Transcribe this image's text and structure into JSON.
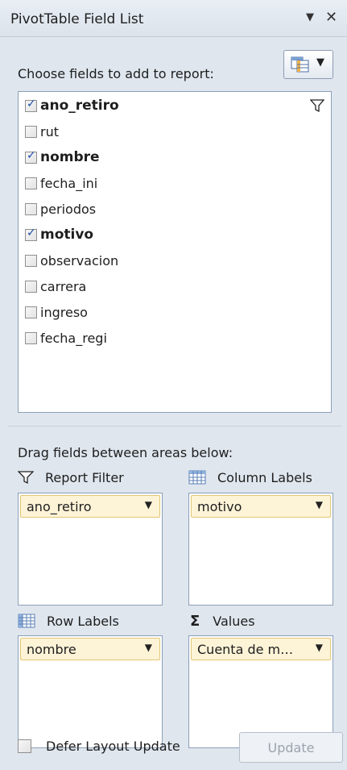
{
  "panel": {
    "title": "PivotTable Field List",
    "dropdown_icon": "triangle-down-icon",
    "close_icon": "close-icon"
  },
  "chooser": {
    "label": "Choose fields to add to report:",
    "layout_button_icon": "field-layout-icon"
  },
  "fields": [
    {
      "name": "ano_retiro",
      "checked": true,
      "filtered": true
    },
    {
      "name": "rut",
      "checked": false
    },
    {
      "name": "nombre",
      "checked": true
    },
    {
      "name": "fecha_ini",
      "checked": false
    },
    {
      "name": "periodos",
      "checked": false
    },
    {
      "name": "motivo",
      "checked": true
    },
    {
      "name": "observacion",
      "checked": false
    },
    {
      "name": "carrera",
      "checked": false
    },
    {
      "name": "ingreso",
      "checked": false
    },
    {
      "name": "fecha_regi",
      "checked": false
    }
  ],
  "areas": {
    "label": "Drag fields between areas below:",
    "report_filter": {
      "title": "Report Filter",
      "field": "ano_retiro"
    },
    "column_labels": {
      "title": "Column Labels",
      "field": "motivo"
    },
    "row_labels": {
      "title": "Row Labels",
      "field": "nombre"
    },
    "values": {
      "title": "Values",
      "field": "Cuenta de m…",
      "icon_glyph": "Σ"
    }
  },
  "footer": {
    "defer_label": "Defer Layout Update",
    "defer_checked": false,
    "update_label": "Update"
  },
  "colors": {
    "background": "#dfe6ee",
    "chip_fill": "#fdf3d7",
    "chip_border": "#e4c774",
    "check_mark": "#1f4ea8"
  }
}
